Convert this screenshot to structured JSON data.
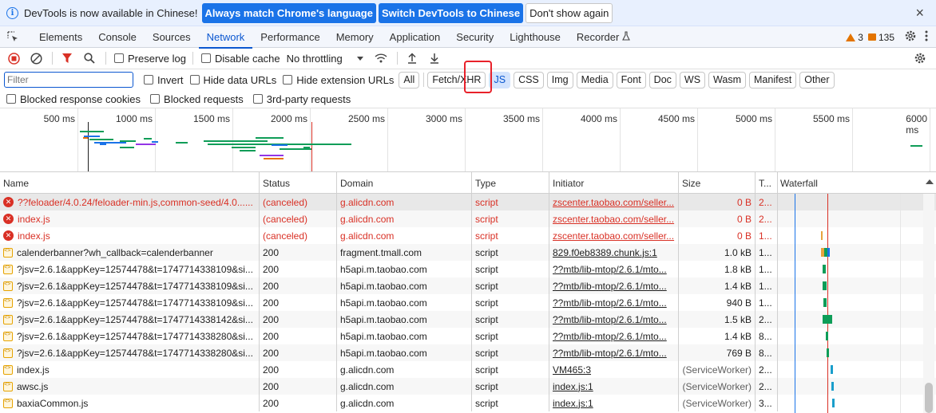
{
  "infobar": {
    "message": "DevTools is now available in Chinese!",
    "primary_button": "Always match Chrome's language",
    "secondary_button": "Switch DevTools to Chinese",
    "dismiss_button": "Don't show again",
    "close": "×"
  },
  "tabs": [
    {
      "label": "Elements"
    },
    {
      "label": "Console"
    },
    {
      "label": "Sources"
    },
    {
      "label": "Network",
      "active": true
    },
    {
      "label": "Performance"
    },
    {
      "label": "Memory"
    },
    {
      "label": "Application"
    },
    {
      "label": "Security"
    },
    {
      "label": "Lighthouse"
    },
    {
      "label": "Recorder"
    }
  ],
  "counters": {
    "warnings": "3",
    "messages": "135"
  },
  "network_toolbar": {
    "preserve_log": "Preserve log",
    "disable_cache": "Disable cache",
    "throttling": "No throttling"
  },
  "filter": {
    "placeholder": "Filter",
    "invert": "Invert",
    "hide_data_urls": "Hide data URLs",
    "hide_extension_urls": "Hide extension URLs",
    "types": [
      "All",
      "Fetch/XHR",
      "JS",
      "CSS",
      "Img",
      "Media",
      "Font",
      "Doc",
      "WS",
      "Wasm",
      "Manifest",
      "Other"
    ],
    "selected_type": "JS"
  },
  "blocked": {
    "blocked_response_cookies": "Blocked response cookies",
    "blocked_requests": "Blocked requests",
    "third_party": "3rd-party requests"
  },
  "overview": {
    "ticks": [
      "500 ms",
      "1000 ms",
      "1500 ms",
      "2000 ms",
      "2500 ms",
      "3000 ms",
      "3500 ms",
      "4000 ms",
      "4500 ms",
      "5000 ms",
      "5500 ms",
      "6000 ms"
    ]
  },
  "columns": {
    "name": "Name",
    "status": "Status",
    "domain": "Domain",
    "type": "Type",
    "initiator": "Initiator",
    "size": "Size",
    "time": "T...",
    "waterfall": "Waterfall"
  },
  "rows": [
    {
      "name": "??feloader/4.0.24/feloader-min.js,common-seed/4.0......",
      "status": "(canceled)",
      "domain": "g.alicdn.com",
      "type": "script",
      "initiator": "zscenter.taobao.com/seller...",
      "size": "0 B",
      "time": "2...",
      "error": true
    },
    {
      "name": "index.js",
      "status": "(canceled)",
      "domain": "g.alicdn.com",
      "type": "script",
      "initiator": "zscenter.taobao.com/seller...",
      "size": "0 B",
      "time": "2...",
      "error": true
    },
    {
      "name": "index.js",
      "status": "(canceled)",
      "domain": "g.alicdn.com",
      "type": "script",
      "initiator": "zscenter.taobao.com/seller...",
      "size": "0 B",
      "time": "1...",
      "error": true
    },
    {
      "name": "calenderbanner?wh_callback=calenderbanner",
      "status": "200",
      "domain": "fragment.tmall.com",
      "type": "script",
      "initiator": "829.f0eb8389.chunk.js:1",
      "size": "1.0 kB",
      "time": "1...",
      "error": false
    },
    {
      "name": "?jsv=2.6.1&appKey=12574478&t=1747714338109&si...",
      "status": "200",
      "domain": "h5api.m.taobao.com",
      "type": "script",
      "initiator": "??mtb/lib-mtop/2.6.1/mto...",
      "size": "1.8 kB",
      "time": "1...",
      "error": false
    },
    {
      "name": "?jsv=2.6.1&appKey=12574478&t=1747714338109&si...",
      "status": "200",
      "domain": "h5api.m.taobao.com",
      "type": "script",
      "initiator": "??mtb/lib-mtop/2.6.1/mto...",
      "size": "1.4 kB",
      "time": "1...",
      "error": false
    },
    {
      "name": "?jsv=2.6.1&appKey=12574478&t=1747714338109&si...",
      "status": "200",
      "domain": "h5api.m.taobao.com",
      "type": "script",
      "initiator": "??mtb/lib-mtop/2.6.1/mto...",
      "size": "940 B",
      "time": "1...",
      "error": false
    },
    {
      "name": "?jsv=2.6.1&appKey=12574478&t=1747714338142&si...",
      "status": "200",
      "domain": "h5api.m.taobao.com",
      "type": "script",
      "initiator": "??mtb/lib-mtop/2.6.1/mto...",
      "size": "1.5 kB",
      "time": "2...",
      "error": false
    },
    {
      "name": "?jsv=2.6.1&appKey=12574478&t=1747714338280&si...",
      "status": "200",
      "domain": "h5api.m.taobao.com",
      "type": "script",
      "initiator": "??mtb/lib-mtop/2.6.1/mto...",
      "size": "1.4 kB",
      "time": "8...",
      "error": false
    },
    {
      "name": "?jsv=2.6.1&appKey=12574478&t=1747714338280&si...",
      "status": "200",
      "domain": "h5api.m.taobao.com",
      "type": "script",
      "initiator": "??mtb/lib-mtop/2.6.1/mto...",
      "size": "769 B",
      "time": "8...",
      "error": false
    },
    {
      "name": "index.js",
      "status": "200",
      "domain": "g.alicdn.com",
      "type": "script",
      "initiator": "VM465:3",
      "size": "(ServiceWorker)",
      "time": "2...",
      "error": false
    },
    {
      "name": "awsc.js",
      "status": "200",
      "domain": "g.alicdn.com",
      "type": "script",
      "initiator": "index.js:1",
      "size": "(ServiceWorker)",
      "time": "2...",
      "error": false
    },
    {
      "name": "baxiaCommon.js",
      "status": "200",
      "domain": "g.alicdn.com",
      "type": "script",
      "initiator": "index.js:1",
      "size": "(ServiceWorker)",
      "time": "3...",
      "error": false
    }
  ],
  "colors": {
    "accent": "#1a73e8",
    "error": "#d93025",
    "highlight": "#e8212a"
  }
}
